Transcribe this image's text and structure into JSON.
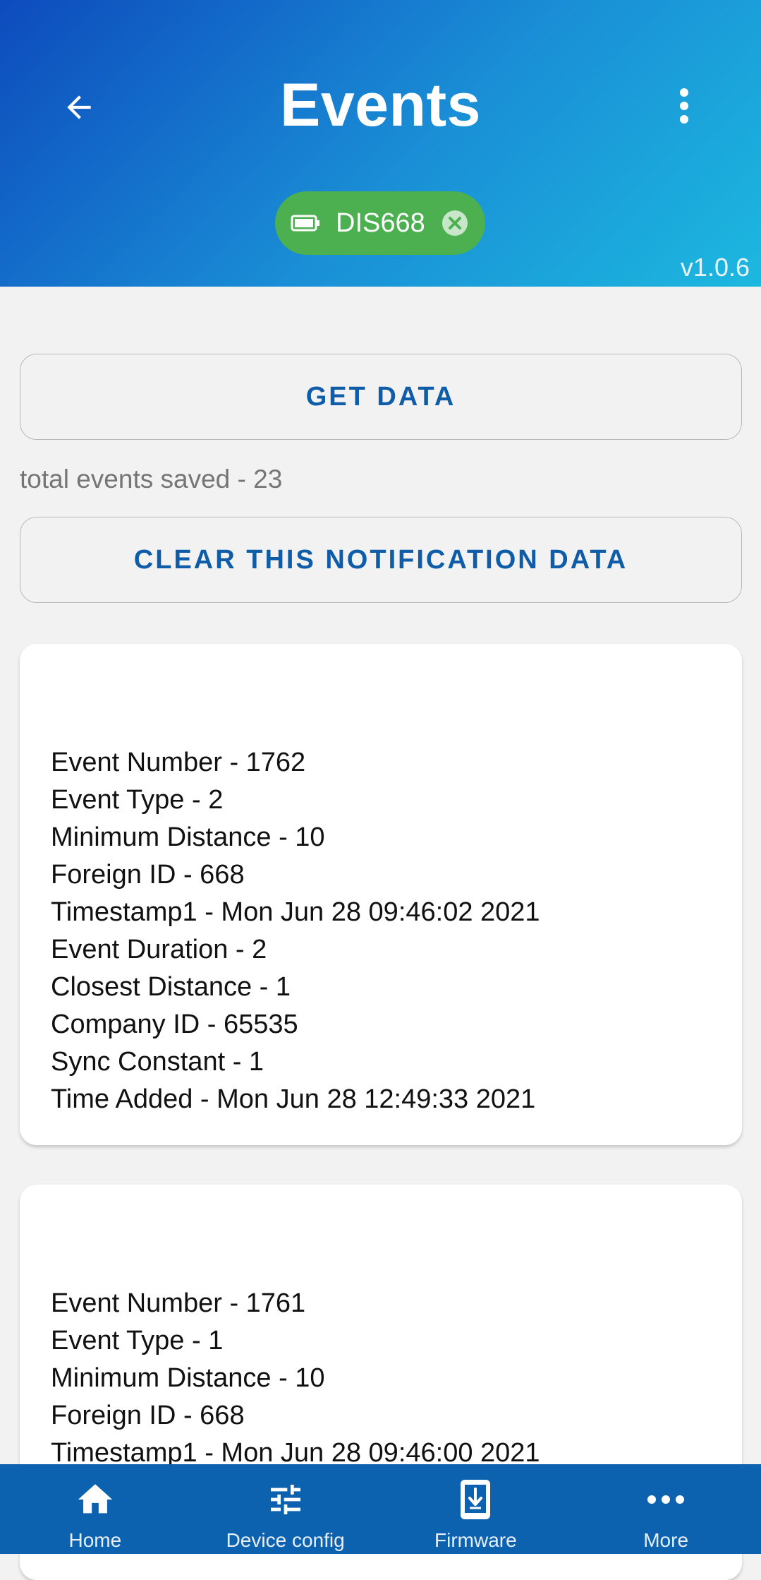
{
  "header": {
    "title": "Events",
    "device_chip": {
      "label": "DIS668"
    },
    "version": "v1.0.6"
  },
  "actions": {
    "get_data_label": "GET DATA",
    "total_events_text": "total events saved - 23",
    "clear_label": "CLEAR THIS NOTIFICATION DATA"
  },
  "events": [
    {
      "lines": [
        "Event Number - 1762",
        "Event Type - 2",
        "Minimum Distance - 10",
        "Foreign ID - 668",
        "Timestamp1 - Mon Jun 28 09:46:02 2021",
        "Event Duration - 2",
        "Closest Distance - 1",
        "Company ID - 65535",
        "Sync Constant - 1",
        "Time Added - Mon Jun 28 12:49:33 2021"
      ]
    },
    {
      "lines": [
        "Event Number - 1761",
        "Event Type - 1",
        "Minimum Distance - 10",
        "Foreign ID - 668",
        "Timestamp1 - Mon Jun 28 09:46:00 2021"
      ]
    }
  ],
  "bottom_nav": {
    "items": [
      {
        "label": "Home",
        "icon": "home-icon"
      },
      {
        "label": "Device config",
        "icon": "sliders-icon"
      },
      {
        "label": "Firmware",
        "icon": "phone-download-icon"
      },
      {
        "label": "More",
        "icon": "more-horizontal-icon"
      }
    ]
  },
  "colors": {
    "header_gradient_start": "#0d4bbd",
    "header_gradient_end": "#1cb8df",
    "chip_green": "#4caf50",
    "accent_blue": "#0f5ca8",
    "nav_blue": "#0d62b0"
  }
}
